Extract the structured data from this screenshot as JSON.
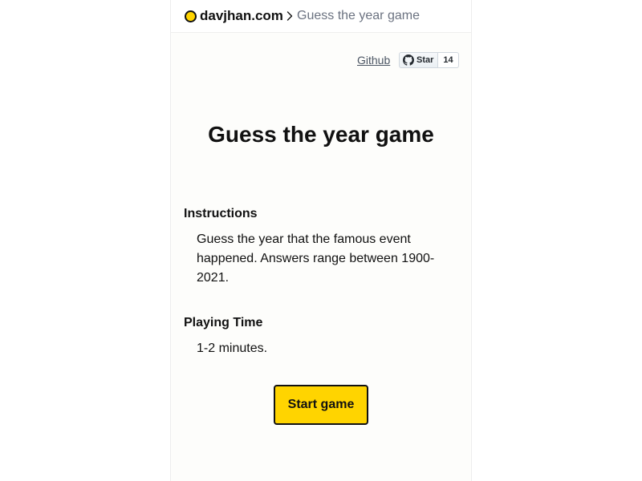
{
  "header": {
    "site_name": "davjhan.com",
    "breadcrumb_current": "Guess the year game",
    "logo_color": "#ffd400"
  },
  "links": {
    "github_label": "Github",
    "star_label": "Star",
    "star_count": "14"
  },
  "main": {
    "title": "Guess the year game",
    "instructions_heading": "Instructions",
    "instructions_text": "Guess the year that the famous event happened. Answers range between 1900-2021.",
    "playing_time_heading": "Playing Time",
    "playing_time_text": "1-2 minutes.",
    "start_button_label": "Start game",
    "accent_color": "#ffd400"
  }
}
